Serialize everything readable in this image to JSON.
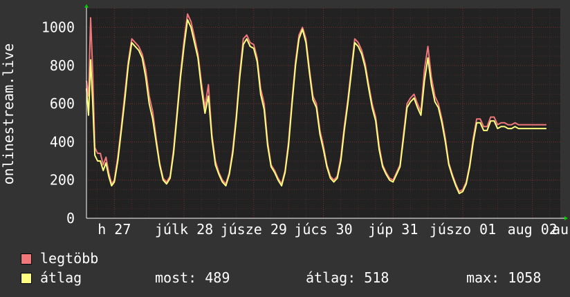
{
  "chart_data": {
    "type": "line",
    "ylabel": "onlinestream.live",
    "ylim": [
      0,
      1100
    ],
    "yticks": [
      0,
      200,
      400,
      600,
      800,
      1000
    ],
    "xlim": [
      26.6,
      33.4
    ],
    "xticks": [
      {
        "x": 27,
        "label": "h 27"
      },
      {
        "x": 28,
        "label": "júlk 28"
      },
      {
        "x": 29,
        "label": "júsze 29"
      },
      {
        "x": 30,
        "label": "júcs 30"
      },
      {
        "x": 31,
        "label": "júp 31"
      },
      {
        "x": 32,
        "label": "júszo 01"
      },
      {
        "x": 33,
        "label": "aug 02"
      },
      {
        "x": 33.4,
        "label": "au"
      }
    ],
    "grid": true,
    "colors": {
      "max": "#f0787a",
      "avg": "#ffff80",
      "plot_bg": "#222222",
      "grid": "#6e2a2a",
      "axis_arrow": "#00cc00"
    },
    "series": [
      {
        "name": "legtöbb",
        "x": [
          26.6,
          26.63,
          26.66,
          26.69,
          26.72,
          26.76,
          26.8,
          26.84,
          26.88,
          26.92,
          26.96,
          27.0,
          27.05,
          27.1,
          27.15,
          27.2,
          27.25,
          27.3,
          27.35,
          27.4,
          27.45,
          27.5,
          27.55,
          27.6,
          27.65,
          27.7,
          27.75,
          27.8,
          27.85,
          27.9,
          27.95,
          28.0,
          28.05,
          28.1,
          28.15,
          28.2,
          28.25,
          28.3,
          28.35,
          28.4,
          28.45,
          28.5,
          28.55,
          28.6,
          28.65,
          28.7,
          28.75,
          28.8,
          28.85,
          28.9,
          28.95,
          29.0,
          29.05,
          29.1,
          29.15,
          29.2,
          29.25,
          29.3,
          29.35,
          29.4,
          29.45,
          29.5,
          29.55,
          29.6,
          29.65,
          29.7,
          29.75,
          29.8,
          29.85,
          29.9,
          29.95,
          30.0,
          30.05,
          30.1,
          30.15,
          30.2,
          30.25,
          30.3,
          30.35,
          30.4,
          30.45,
          30.5,
          30.55,
          30.6,
          30.65,
          30.7,
          30.75,
          30.8,
          30.85,
          30.9,
          30.95,
          31.0,
          31.05,
          31.1,
          31.15,
          31.2,
          31.25,
          31.3,
          31.35,
          31.4,
          31.45,
          31.5,
          31.55,
          31.6,
          31.65,
          31.7,
          31.75,
          31.8,
          31.85,
          31.9,
          31.95,
          32.0,
          32.05,
          32.1,
          32.15,
          32.2,
          32.25,
          32.3,
          32.35,
          32.4,
          32.45,
          32.5,
          32.55,
          32.6,
          32.65,
          32.7,
          32.75,
          32.8,
          32.85,
          32.9,
          32.95,
          33.0,
          33.05,
          33.1,
          33.15,
          33.2
        ],
        "values": [
          720,
          640,
          1050,
          760,
          370,
          340,
          340,
          280,
          320,
          240,
          180,
          200,
          320,
          480,
          650,
          820,
          940,
          920,
          900,
          860,
          780,
          640,
          560,
          420,
          290,
          210,
          190,
          220,
          360,
          560,
          760,
          930,
          1070,
          1030,
          950,
          860,
          710,
          580,
          700,
          440,
          300,
          240,
          200,
          180,
          240,
          360,
          540,
          760,
          940,
          960,
          920,
          910,
          840,
          680,
          600,
          400,
          280,
          250,
          210,
          180,
          250,
          400,
          620,
          820,
          960,
          1000,
          940,
          780,
          640,
          600,
          460,
          380,
          280,
          220,
          200,
          220,
          320,
          480,
          620,
          780,
          940,
          920,
          880,
          810,
          700,
          600,
          530,
          380,
          280,
          240,
          210,
          200,
          240,
          280,
          440,
          600,
          630,
          650,
          600,
          560,
          780,
          900,
          740,
          640,
          600,
          520,
          420,
          290,
          230,
          180,
          140,
          150,
          190,
          280,
          420,
          520,
          520,
          480,
          480,
          530,
          530,
          490,
          500,
          500,
          490,
          490,
          500,
          490,
          490,
          490,
          490,
          490,
          490,
          490,
          490,
          490
        ]
      },
      {
        "name": "átlag",
        "x": [
          26.6,
          26.63,
          26.66,
          26.69,
          26.72,
          26.76,
          26.8,
          26.84,
          26.88,
          26.92,
          26.96,
          27.0,
          27.05,
          27.1,
          27.15,
          27.2,
          27.25,
          27.3,
          27.35,
          27.4,
          27.45,
          27.5,
          27.55,
          27.6,
          27.65,
          27.7,
          27.75,
          27.8,
          27.85,
          27.9,
          27.95,
          28.0,
          28.05,
          28.1,
          28.15,
          28.2,
          28.25,
          28.3,
          28.35,
          28.4,
          28.45,
          28.5,
          28.55,
          28.6,
          28.65,
          28.7,
          28.75,
          28.8,
          28.85,
          28.9,
          28.95,
          29.0,
          29.05,
          29.1,
          29.15,
          29.2,
          29.25,
          29.3,
          29.35,
          29.4,
          29.45,
          29.5,
          29.55,
          29.6,
          29.65,
          29.7,
          29.75,
          29.8,
          29.85,
          29.9,
          29.95,
          30.0,
          30.05,
          30.1,
          30.15,
          30.2,
          30.25,
          30.3,
          30.35,
          30.4,
          30.45,
          30.5,
          30.55,
          30.6,
          30.65,
          30.7,
          30.75,
          30.8,
          30.85,
          30.9,
          30.95,
          31.0,
          31.05,
          31.1,
          31.15,
          31.2,
          31.25,
          31.3,
          31.35,
          31.4,
          31.45,
          31.5,
          31.55,
          31.6,
          31.65,
          31.7,
          31.75,
          31.8,
          31.85,
          31.9,
          31.95,
          32.0,
          32.05,
          32.1,
          32.15,
          32.2,
          32.25,
          32.3,
          32.35,
          32.4,
          32.45,
          32.5,
          32.55,
          32.6,
          32.65,
          32.7,
          32.75,
          32.8,
          32.85,
          32.9,
          32.95,
          33.0,
          33.05,
          33.1,
          33.15,
          33.2
        ],
        "values": [
          680,
          540,
          830,
          600,
          330,
          300,
          300,
          250,
          290,
          220,
          170,
          190,
          300,
          460,
          620,
          800,
          920,
          900,
          880,
          840,
          740,
          600,
          520,
          400,
          280,
          200,
          180,
          210,
          340,
          540,
          740,
          900,
          1040,
          1000,
          920,
          840,
          680,
          550,
          640,
          420,
          280,
          230,
          190,
          170,
          230,
          340,
          520,
          740,
          910,
          940,
          900,
          890,
          820,
          650,
          570,
          380,
          270,
          240,
          200,
          170,
          240,
          380,
          600,
          800,
          940,
          990,
          920,
          760,
          620,
          580,
          440,
          360,
          270,
          210,
          190,
          210,
          300,
          460,
          600,
          760,
          920,
          900,
          860,
          790,
          680,
          580,
          510,
          360,
          270,
          230,
          200,
          190,
          230,
          270,
          420,
          580,
          610,
          630,
          580,
          540,
          720,
          840,
          700,
          610,
          580,
          500,
          400,
          280,
          220,
          170,
          130,
          140,
          180,
          270,
          400,
          500,
          500,
          460,
          460,
          510,
          510,
          470,
          480,
          480,
          470,
          470,
          480,
          470,
          470,
          470,
          470,
          470,
          470,
          470,
          470,
          470
        ]
      }
    ]
  },
  "legend": [
    {
      "label": "legtöbb",
      "color": "#f0787a"
    },
    {
      "label": "átlag",
      "color": "#ffff80"
    }
  ],
  "stats": {
    "most": "most: 489",
    "atlag": "átlag: 518",
    "max": "max: 1058"
  }
}
